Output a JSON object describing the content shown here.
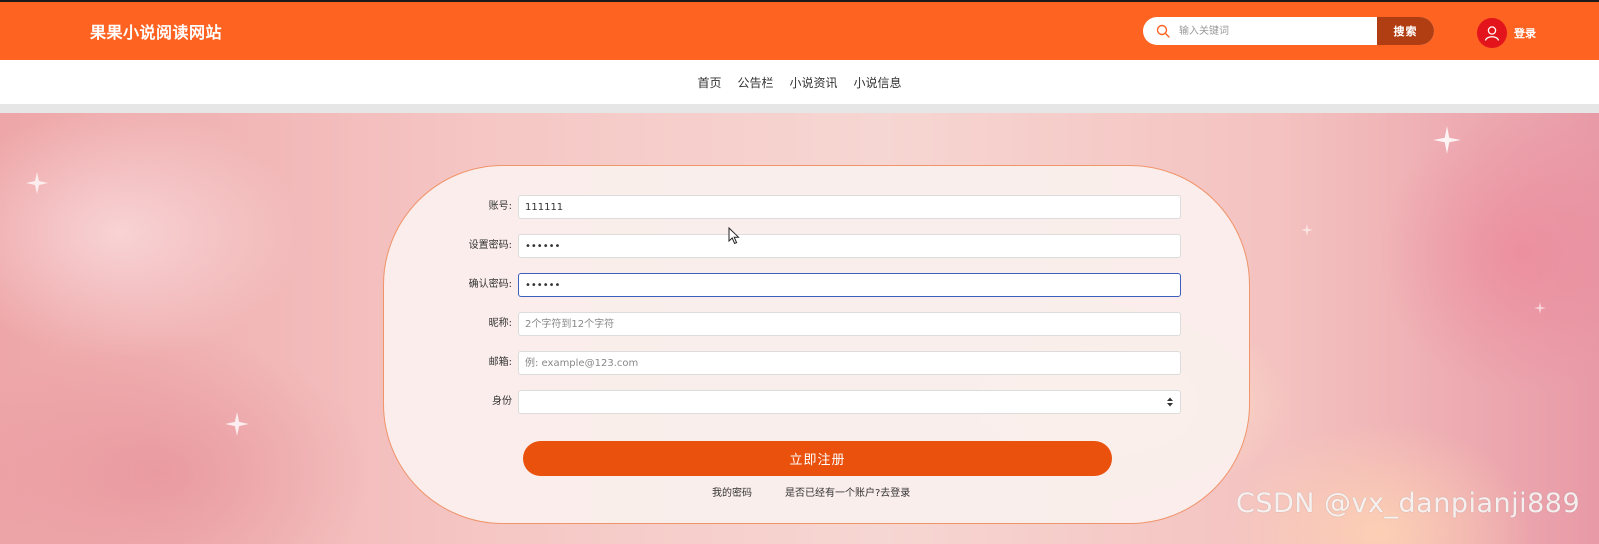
{
  "header": {
    "site_title": "果果小说阅读网站",
    "search_placeholder": "输入关键词",
    "search_button": "搜索",
    "login_label": "登录"
  },
  "nav": {
    "items": [
      {
        "label": "首页"
      },
      {
        "label": "公告栏"
      },
      {
        "label": "小说资讯"
      },
      {
        "label": "小说信息"
      }
    ]
  },
  "form": {
    "fields": [
      {
        "label": "账号:",
        "value": "111111",
        "placeholder": ""
      },
      {
        "label": "设置密码:",
        "value": "••••••",
        "placeholder": ""
      },
      {
        "label": "确认密码:",
        "value": "••••••",
        "placeholder": ""
      },
      {
        "label": "昵称:",
        "value": "",
        "placeholder": "2个字符到12个字符"
      },
      {
        "label": "邮箱:",
        "value": "",
        "placeholder": "例: example@123.com"
      },
      {
        "label": "身份",
        "value": "",
        "placeholder": ""
      }
    ],
    "submit_label": "立即注册",
    "back_link": "我的密码",
    "login_link": "是否已经有一个账户?去登录"
  },
  "watermark": "CSDN @vx_danpianji889",
  "colors": {
    "header_bg": "#fe6322",
    "search_button_bg": "#b13d12",
    "submit_bg": "#e9510d",
    "avatar_bg": "#e3141c"
  }
}
